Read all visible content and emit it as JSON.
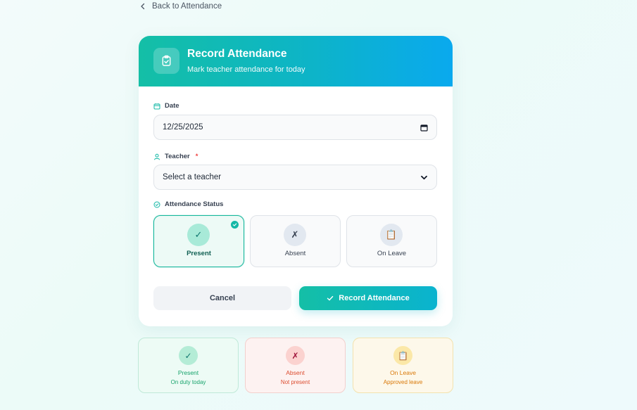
{
  "nav": {
    "back_label": "Back to Attendance"
  },
  "header": {
    "title": "Record Attendance",
    "subtitle": "Mark teacher attendance for today"
  },
  "form": {
    "date": {
      "label": "Date",
      "value": "12/25/2025"
    },
    "teacher": {
      "label": "Teacher",
      "required_mark": "*",
      "value": "Select a teacher"
    },
    "status": {
      "label": "Attendance Status",
      "selected": "Present",
      "options": [
        {
          "label": "Present",
          "glyph": "✓"
        },
        {
          "label": "Absent",
          "glyph": "✗"
        },
        {
          "label": "On Leave",
          "glyph": "📋"
        }
      ]
    },
    "cancel_label": "Cancel",
    "submit_label": "Record Attendance"
  },
  "summary": [
    {
      "glyph": "✓",
      "title": "Present",
      "subtitle": "On duty today"
    },
    {
      "glyph": "✗",
      "title": "Absent",
      "subtitle": "Not present"
    },
    {
      "glyph": "📋",
      "title": "On Leave",
      "subtitle": "Approved leave"
    }
  ],
  "colors": {
    "accent": "#14bfa6",
    "accent_blue": "#0aa9ee",
    "present": "#16a36b",
    "absent": "#dc4c2f",
    "leave": "#d97706"
  },
  "icons": {
    "back": "chevron-left-icon",
    "header": "clipboard-check-icon",
    "date": "calendar-icon",
    "teacher": "user-icon",
    "status": "check-circle-icon"
  }
}
